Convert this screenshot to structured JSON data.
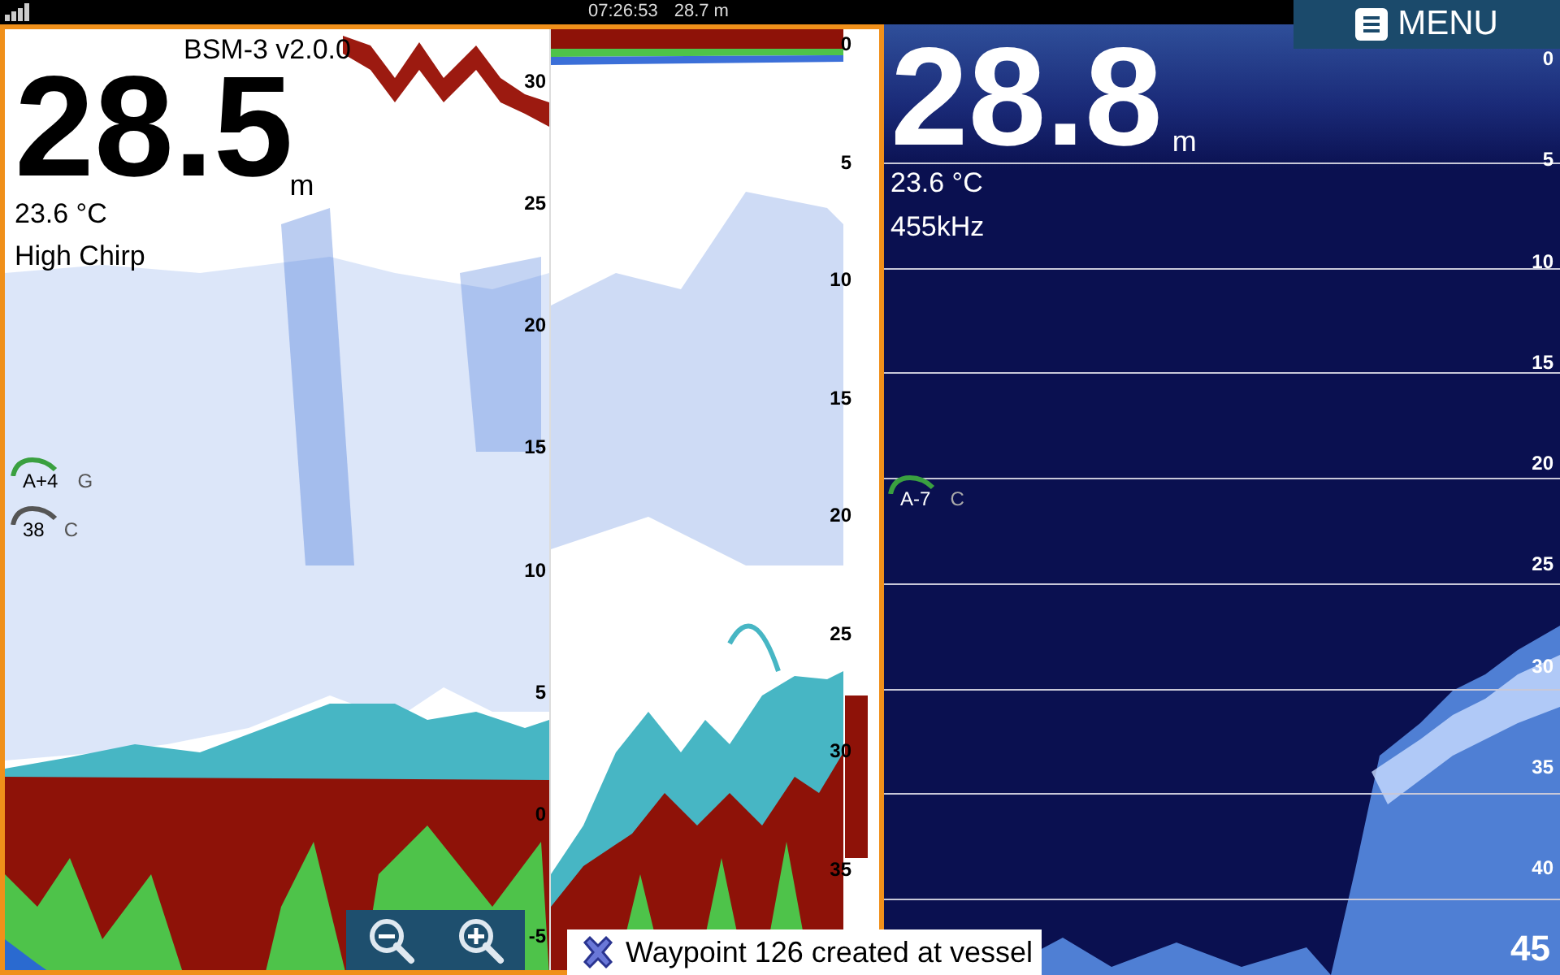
{
  "status_bar": {
    "time": "07:26:53",
    "depth": "28.7 m"
  },
  "menu_button": {
    "label": "MENU"
  },
  "left_panel": {
    "version": "BSM-3 v2.0.0",
    "depth": "28.5",
    "unit": "m",
    "temperature": "23.6 °C",
    "mode": "High Chirp",
    "gauges": [
      {
        "label": "A+4",
        "suffix": "G",
        "color": "#3aa040"
      },
      {
        "label": "38",
        "suffix": "C",
        "color": "#555555"
      }
    ],
    "scale": [
      "30",
      "25",
      "20",
      "15",
      "10",
      "5",
      "0",
      "-5"
    ],
    "zoom_scale": [
      "0",
      "5",
      "10",
      "15",
      "20",
      "25",
      "30",
      "35"
    ]
  },
  "right_panel": {
    "depth": "28.8",
    "unit": "m",
    "temperature": "23.6 °C",
    "frequency": "455kHz",
    "gauges": [
      {
        "label": "A-7",
        "suffix": "C",
        "color": "#3aa040"
      }
    ],
    "scale": [
      "0",
      "5",
      "10",
      "15",
      "20",
      "25",
      "30",
      "35",
      "40"
    ],
    "range": "45"
  },
  "zoom_buttons": [
    {
      "kind": "out"
    },
    {
      "kind": "in"
    }
  ],
  "notification": {
    "text": "Waypoint 126 created at vessel"
  }
}
